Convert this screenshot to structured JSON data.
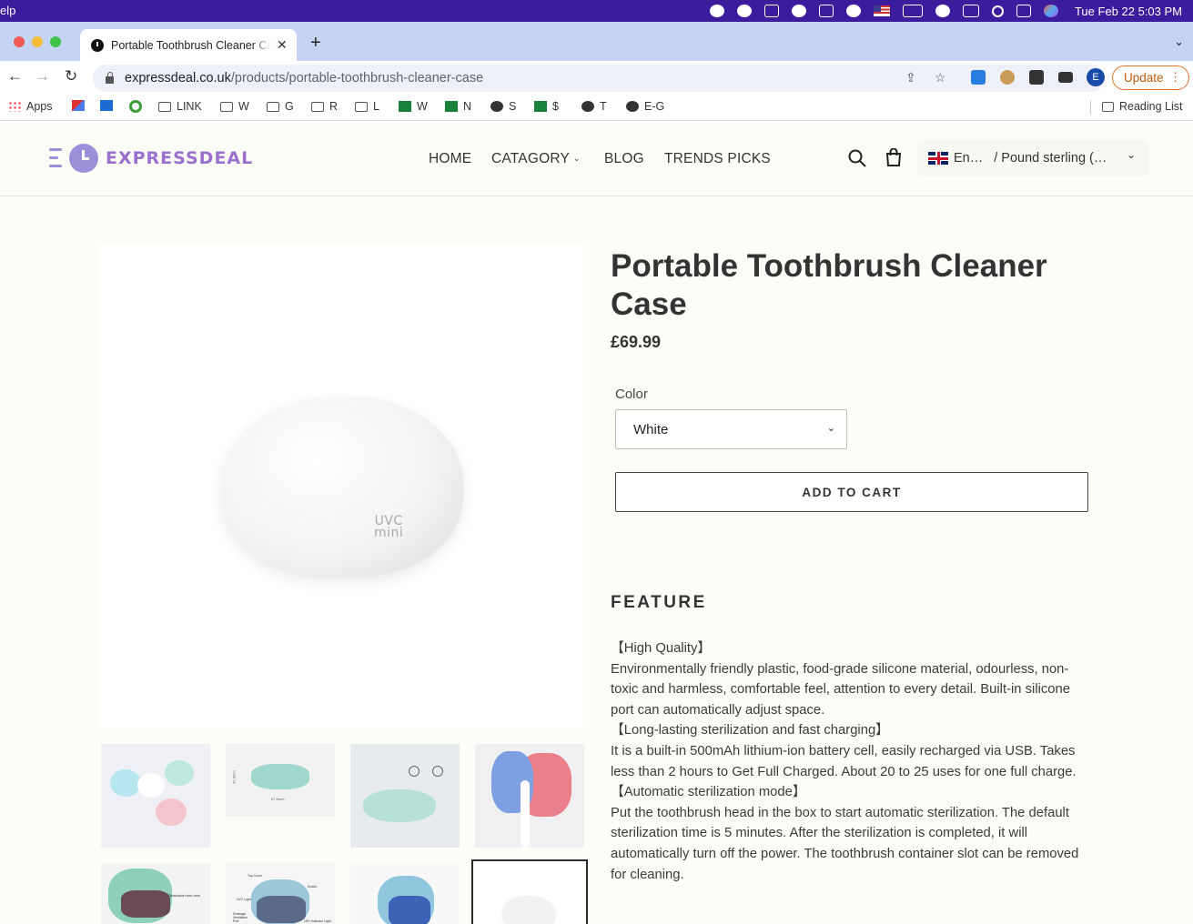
{
  "menubar": {
    "app_fragment": "elp",
    "clock": "Tue Feb 22  5:03 PM"
  },
  "browser": {
    "tab_title": "Portable Toothbrush Cleaner Case",
    "url_host": "expressdeal.co.uk",
    "url_path": "/products/portable-toothbrush-cleaner-case",
    "profile_initial": "E",
    "update_label": "Update",
    "bookmarks": [
      {
        "label": "Apps",
        "icon": "apps-grid-icon"
      },
      {
        "label": "",
        "icon": "gmail-icon"
      },
      {
        "label": "",
        "icon": "outlook-icon"
      },
      {
        "label": "",
        "icon": "grammarly-icon"
      },
      {
        "label": "LINK",
        "icon": "folder-icon"
      },
      {
        "label": "W",
        "icon": "folder-icon"
      },
      {
        "label": "G",
        "icon": "folder-icon"
      },
      {
        "label": "R",
        "icon": "folder-icon"
      },
      {
        "label": "L",
        "icon": "folder-icon"
      },
      {
        "label": "W",
        "icon": "sheets-icon"
      },
      {
        "label": "N",
        "icon": "sheets-icon"
      },
      {
        "label": "S",
        "icon": "globe-icon"
      },
      {
        "label": "$",
        "icon": "sheets-icon"
      },
      {
        "label": "T",
        "icon": "globe-icon"
      },
      {
        "label": "E-G",
        "icon": "globe-icon"
      }
    ],
    "reading_list": "Reading List"
  },
  "site": {
    "logo_text": "EXPRESSDEAL",
    "nav": {
      "home": "HOME",
      "category": "CATAGORY",
      "blog": "BLOG",
      "trends": "TRENDS PICKS"
    },
    "locale_language": "En…",
    "locale_currency": "/ Pound sterling (…"
  },
  "product": {
    "main_image_text_1": "UVC",
    "main_image_text_2": "mini",
    "title": "Portable Toothbrush Cleaner Case",
    "price": "£69.99",
    "color_label": "Color",
    "color_value": "White",
    "add_to_cart": "ADD TO CART",
    "feature_heading": "FEATURE",
    "description": [
      "【High Quality】",
      "Environmentally friendly plastic, food-grade silicone material, odourless, non-toxic and harmless, comfortable feel, attention to every detail. Built-in silicone port can automatically adjust space.",
      "【Long-lasting sterilization and fast charging】",
      "It is a built-in 500mAh lithium-ion battery cell, easily recharged via USB. Takes less than 2 hours to Get Full Charged. About 20 to 25 uses for one full charge.",
      "【Automatic sterilization mode】",
      "Put the toothbrush head in the box to start automatic sterilization. The default sterilization time is 5 minutes. After the sterilization is completed, it will automatically turn off the power. The toothbrush container slot can be removed for cleaning."
    ],
    "thumb_dims": {
      "height_label": "62.5mm",
      "width_label": "67.5mm"
    },
    "thumb_labels": {
      "removable": "Detachable inner case",
      "top_cover": "Top Cover",
      "switch": "Switch",
      "uvc_light": "UVC Light",
      "drainage": "Drainage Ventilation Port",
      "led": "LED Indicator Light"
    }
  },
  "colors": {
    "menubar": "#3b1c9c",
    "tabbar": "#c6d4f3",
    "logo": "#9b6fce",
    "page_bg": "#fdfdf8"
  }
}
